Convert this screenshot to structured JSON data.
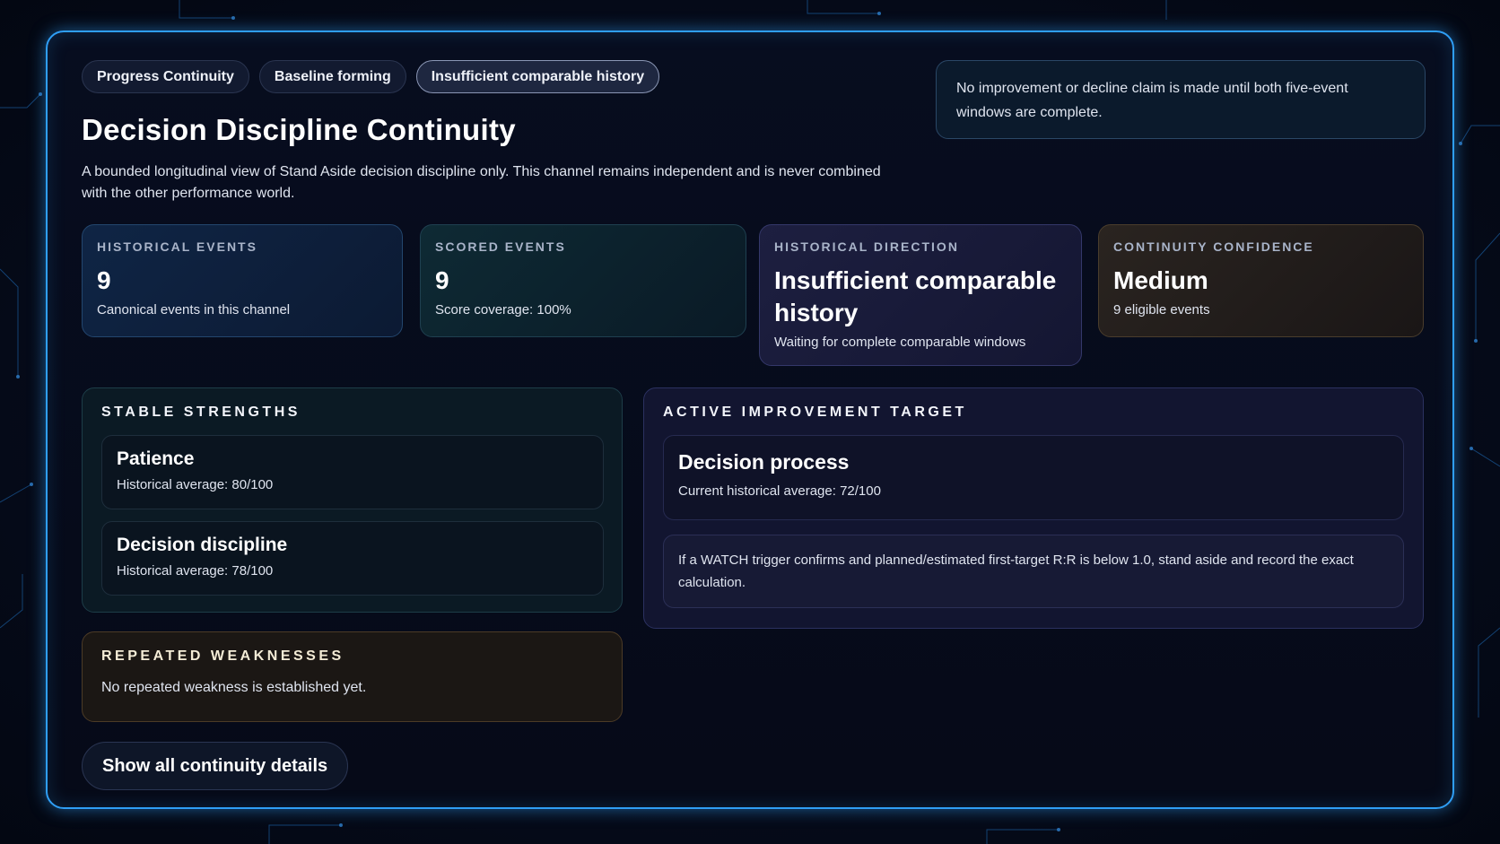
{
  "chips": [
    {
      "label": "Progress Continuity"
    },
    {
      "label": "Baseline forming"
    },
    {
      "label": "Insufficient comparable history",
      "active": true
    }
  ],
  "title": "Decision Discipline Continuity",
  "description": "A bounded longitudinal view of Stand Aside decision discipline only. This channel remains independent and is never combined with the other performance world.",
  "notice": "No improvement or decline claim is made until both five-event windows are complete.",
  "stats": [
    {
      "label": "HISTORICAL EVENTS",
      "value": "9",
      "sub": "Canonical events in this channel"
    },
    {
      "label": "SCORED EVENTS",
      "value": "9",
      "sub": "Score coverage: 100%"
    },
    {
      "label": "HISTORICAL DIRECTION",
      "value": "Insufficient comparable history",
      "sub": "Waiting for complete comparable windows"
    },
    {
      "label": "CONTINUITY CONFIDENCE",
      "value": "Medium",
      "sub": "9 eligible events"
    }
  ],
  "strengths": {
    "heading": "STABLE STRENGTHS",
    "items": [
      {
        "name": "Patience",
        "meta": "Historical average: 80/100"
      },
      {
        "name": "Decision discipline",
        "meta": "Historical average: 78/100"
      }
    ]
  },
  "improvement": {
    "heading": "ACTIVE IMPROVEMENT TARGET",
    "target_name": "Decision process",
    "target_meta": "Current historical average: 72/100",
    "rule": "If a WATCH trigger confirms and planned/estimated first-target R:R is below 1.0, stand aside and record the exact calculation."
  },
  "weaknesses": {
    "heading": "REPEATED WEAKNESSES",
    "text": "No repeated weakness is established yet."
  },
  "show_button": "Show all continuity details",
  "colors": {
    "accent_border": "#2f9ef5",
    "background": "#060b1a"
  }
}
